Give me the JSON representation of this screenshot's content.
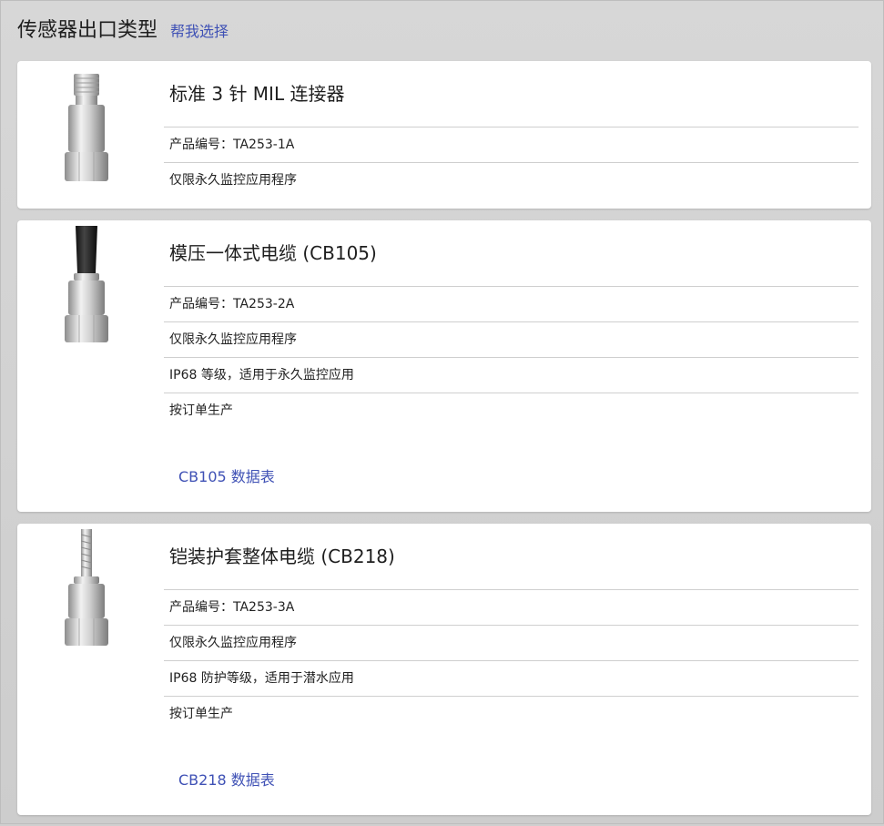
{
  "header": {
    "title": "传感器出口类型",
    "help_link": "帮我选择"
  },
  "cards": [
    {
      "title": "标准 3 针 MIL 连接器",
      "rows": [
        "产品编号：TA253-1A",
        "仅限永久监控应用程序"
      ],
      "image": "sensor-mil-connector"
    },
    {
      "title": "模压一体式电缆 (CB105)",
      "rows": [
        "产品编号：TA253-2A",
        "仅限永久监控应用程序",
        "IP68 等级，适用于永久监控应用",
        "按订单生产"
      ],
      "datasheet": "CB105 数据表",
      "image": "sensor-molded-cable"
    },
    {
      "title": "铠装护套整体电缆 (CB218)",
      "rows": [
        "产品编号：TA253-3A",
        "仅限永久监控应用程序",
        "IP68 防护等级，适用于潜水应用",
        "按订单生产"
      ],
      "datasheet": "CB218 数据表",
      "image": "sensor-armored-cable"
    }
  ]
}
